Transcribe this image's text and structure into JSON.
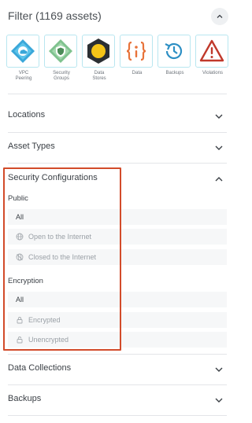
{
  "header": {
    "title": "Filter (1169 assets)"
  },
  "tiles": [
    {
      "label": "VPC\nPeering",
      "icon": "vpc-peering-icon"
    },
    {
      "label": "Security\nGroups",
      "icon": "security-groups-icon"
    },
    {
      "label": "Data\nStores",
      "icon": "data-stores-icon"
    },
    {
      "label": "Data",
      "icon": "data-icon"
    },
    {
      "label": "Backups",
      "icon": "backups-icon"
    },
    {
      "label": "Violations",
      "icon": "violations-icon"
    }
  ],
  "sections": {
    "locations": "Locations",
    "asset_types": "Asset Types",
    "security_configurations": "Security Configurations",
    "data_collections": "Data Collections",
    "backups": "Backups"
  },
  "security": {
    "public": {
      "label": "Public",
      "all": "All",
      "open": "Open to the Internet",
      "closed": "Closed to the Internet"
    },
    "encryption": {
      "label": "Encryption",
      "all": "All",
      "encrypted": "Encrypted",
      "unencrypted": "Unencrypted"
    }
  },
  "colors": {
    "highlight": "#d24b2a",
    "tile_border": "#b8e6f0",
    "accent_orange": "#e8733a",
    "violation_red": "#c0392b"
  }
}
